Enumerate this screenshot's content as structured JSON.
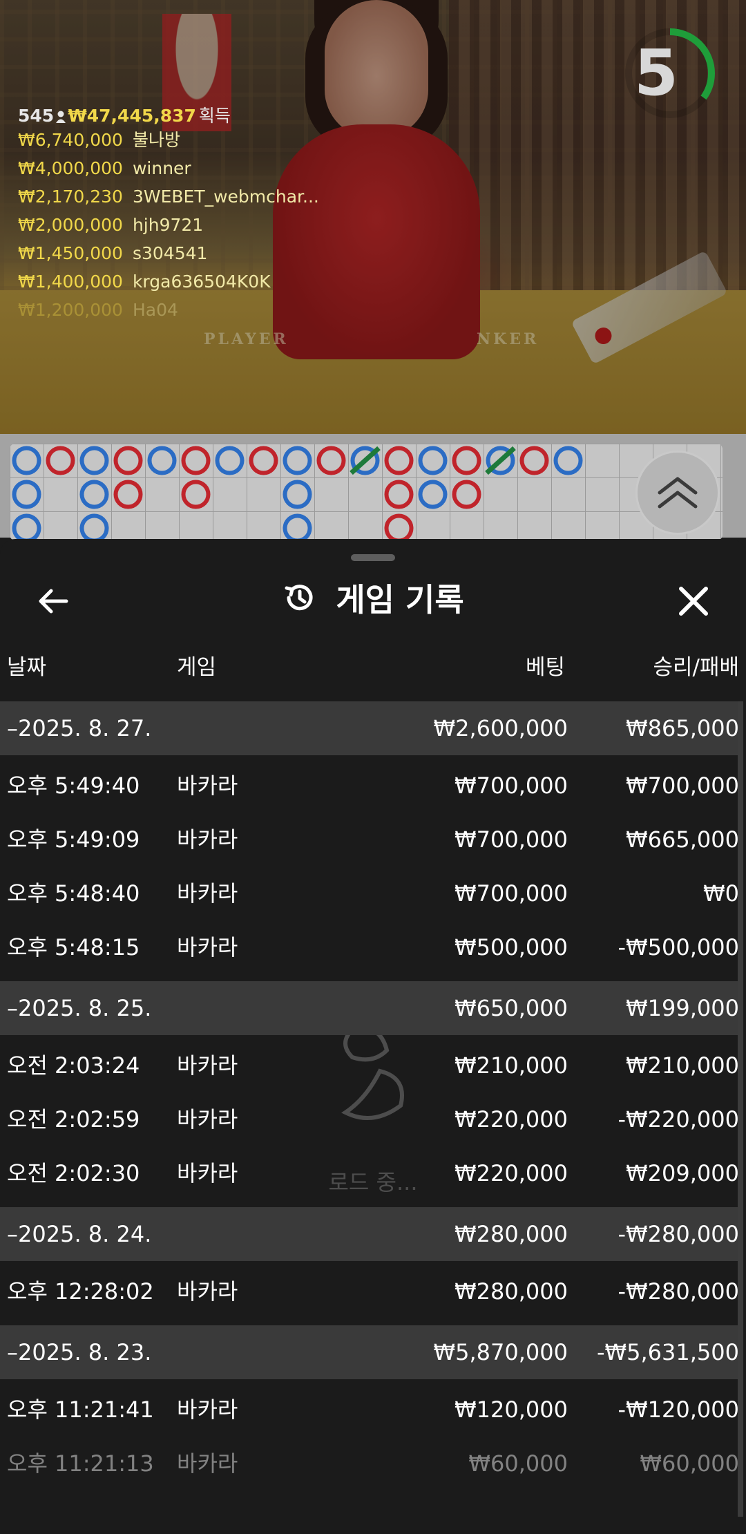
{
  "video": {
    "player_count": "545",
    "total_winnings": "₩47,445,837",
    "winnings_label": "획득",
    "felt_left": "PLAYER",
    "felt_right": "NKER",
    "countdown": "5",
    "countdown_fraction": 0.35,
    "winners": [
      {
        "amount": "₩6,740,000",
        "name": "불나방"
      },
      {
        "amount": "₩4,000,000",
        "name": "winner"
      },
      {
        "amount": "₩2,170,230",
        "name": "3WEBET_webmchar..."
      },
      {
        "amount": "₩2,000,000",
        "name": "hjh9721"
      },
      {
        "amount": "₩1,450,000",
        "name": "s304541"
      },
      {
        "amount": "₩1,400,000",
        "name": "krga636504K0K"
      },
      {
        "amount": "₩1,200,000",
        "name": "Ha04"
      }
    ]
  },
  "roadmap": {
    "colors": {
      "player": "#2b6cc4",
      "banker": "#c0242b",
      "tie": "#1e7a3a"
    },
    "columns": [
      [
        "player",
        "player",
        "player"
      ],
      [
        "banker"
      ],
      [
        "player",
        "player",
        "player"
      ],
      [
        "banker",
        "banker"
      ],
      [
        "player"
      ],
      [
        "banker",
        "banker"
      ],
      [
        "player"
      ],
      [
        "banker"
      ],
      [
        "player",
        "player",
        "player"
      ],
      [
        "banker"
      ],
      [
        "player-tie"
      ],
      [
        "banker",
        "banker",
        "banker"
      ],
      [
        "player",
        "player"
      ],
      [
        "banker",
        "banker"
      ],
      [
        "player-tie"
      ],
      [
        "banker"
      ],
      [
        "player"
      ]
    ]
  },
  "sheet": {
    "title": "게임 기록",
    "columns": {
      "date": "날짜",
      "game": "게임",
      "bet": "베팅",
      "result": "승리/패배"
    },
    "loading_text": "로드 중...",
    "groups": [
      {
        "date": "–2025. 8. 27.",
        "bet": "₩2,600,000",
        "result": "₩865,000",
        "rows": [
          {
            "time": "오후 5:49:40",
            "game": "바카라",
            "bet": "₩700,000",
            "result": "₩700,000"
          },
          {
            "time": "오후 5:49:09",
            "game": "바카라",
            "bet": "₩700,000",
            "result": "₩665,000"
          },
          {
            "time": "오후 5:48:40",
            "game": "바카라",
            "bet": "₩700,000",
            "result": "₩0"
          },
          {
            "time": "오후 5:48:15",
            "game": "바카라",
            "bet": "₩500,000",
            "result": "-₩500,000"
          }
        ]
      },
      {
        "date": "–2025. 8. 25.",
        "bet": "₩650,000",
        "result": "₩199,000",
        "rows": [
          {
            "time": "오전 2:03:24",
            "game": "바카라",
            "bet": "₩210,000",
            "result": "₩210,000"
          },
          {
            "time": "오전 2:02:59",
            "game": "바카라",
            "bet": "₩220,000",
            "result": "-₩220,000"
          },
          {
            "time": "오전 2:02:30",
            "game": "바카라",
            "bet": "₩220,000",
            "result": "₩209,000"
          }
        ]
      },
      {
        "date": "–2025. 8. 24.",
        "bet": "₩280,000",
        "result": "-₩280,000",
        "rows": [
          {
            "time": "오후 12:28:02",
            "game": "바카라",
            "bet": "₩280,000",
            "result": "-₩280,000"
          }
        ]
      },
      {
        "date": "–2025. 8. 23.",
        "bet": "₩5,870,000",
        "result": "-₩5,631,500",
        "rows": [
          {
            "time": "오후 11:21:41",
            "game": "바카라",
            "bet": "₩120,000",
            "result": "-₩120,000"
          },
          {
            "time": "오후 11:21:13",
            "game": "바카라",
            "bet": "₩60,000",
            "result": "₩60,000"
          }
        ]
      }
    ]
  }
}
